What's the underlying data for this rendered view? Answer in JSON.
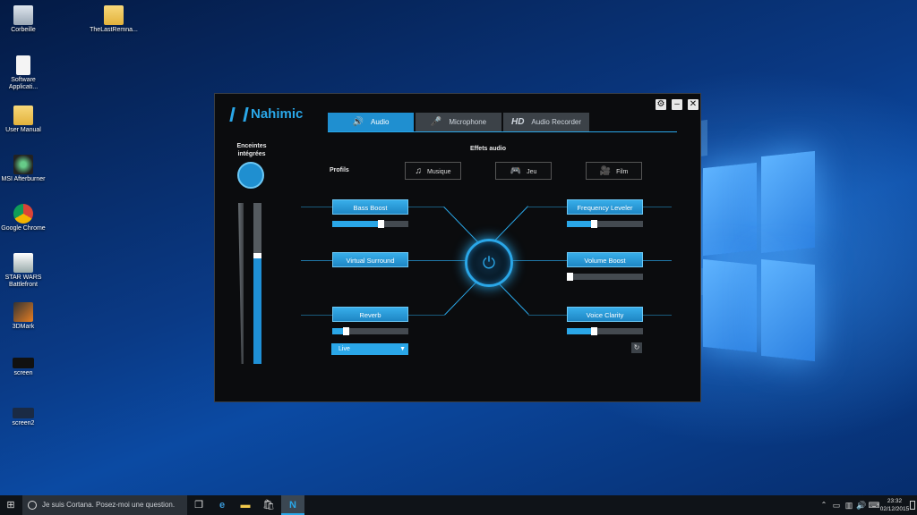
{
  "desktop": {
    "icons": [
      {
        "label": "Corbeille"
      },
      {
        "label": "TheLastRemna..."
      },
      {
        "label": "Software Applicati..."
      },
      {
        "label": "User Manual"
      },
      {
        "label": "MSI Afterburner"
      },
      {
        "label": "Google Chrome"
      },
      {
        "label": "STAR WARS Battlefront"
      },
      {
        "label": "3DMark"
      },
      {
        "label": "screen"
      },
      {
        "label": "screen2"
      }
    ]
  },
  "app": {
    "title": "Nahimic",
    "tabs": [
      {
        "label": "Audio",
        "icon": "speaker-icon",
        "glyph": "🔊",
        "active": true
      },
      {
        "label": "Microphone",
        "icon": "microphone-icon",
        "glyph": "🎤",
        "active": false
      },
      {
        "label": "Audio Recorder",
        "icon": "hd-icon",
        "glyph": "HD",
        "active": false
      }
    ],
    "device": {
      "label": "Enceintes intégrées"
    },
    "effects_heading": "Effets audio",
    "profiles": {
      "label": "Profils",
      "items": [
        {
          "label": "Musique",
          "icon": "music-note-icon",
          "glyph": "♫"
        },
        {
          "label": "Jeu",
          "icon": "gamepad-icon",
          "glyph": "🎮"
        },
        {
          "label": "Film",
          "icon": "camera-icon",
          "glyph": "🎥"
        }
      ]
    },
    "effects_left": [
      {
        "label": "Bass Boost",
        "level": 0.65
      },
      {
        "label": "Virtual Surround"
      },
      {
        "label": "Reverb",
        "level": 0.15
      }
    ],
    "effects_right": [
      {
        "label": "Frequency Leveler",
        "level": 0.35
      },
      {
        "label": "Volume Boost",
        "level": 0.0
      },
      {
        "label": "Voice Clarity",
        "level": 0.35
      }
    ],
    "reverb_preset": "Live",
    "volume_level": 0.67,
    "accent": "#2aa7e8"
  },
  "taskbar": {
    "search_placeholder": "Je suis Cortana. Posez-moi une question.",
    "clock_time": "23:32",
    "clock_date": "02/12/2015"
  }
}
